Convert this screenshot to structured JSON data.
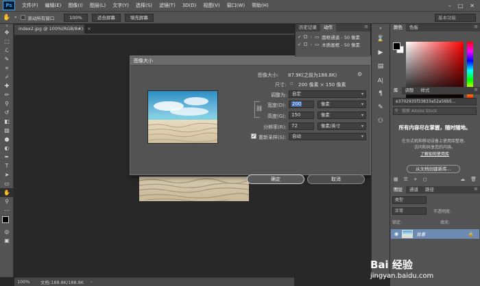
{
  "menu": {
    "logo": "Ps",
    "items": [
      "文件(F)",
      "编辑(E)",
      "图像(I)",
      "图层(L)",
      "文字(Y)",
      "选择(S)",
      "滤镜(T)",
      "3D(D)",
      "视图(V)",
      "窗口(W)",
      "帮助(H)"
    ],
    "window_controls": [
      "–",
      "□",
      "✕"
    ]
  },
  "options": {
    "scroll_all_windows": "滚动所有窗口",
    "zoom_value": "100%",
    "fit_screen": "适合屏幕",
    "fill_screen": "填充屏幕",
    "workspace": "基本功能"
  },
  "document": {
    "tab_title": "index2.jpg @ 100%(RGB/8#)",
    "tab_close": "×"
  },
  "status": {
    "zoom": "100%",
    "doc_size": "文档:188.8K/188.8K",
    "arrow": "›"
  },
  "history_panel": {
    "tabs": [
      "历史记录",
      "动作"
    ],
    "rows": [
      {
        "check": "✓",
        "label": "圆框通道 - 50 像素"
      },
      {
        "check": "✓",
        "label": "木质画框 - 50 像素"
      }
    ]
  },
  "dialog": {
    "title": "图像大小",
    "image_size_label": "图像大小:",
    "image_size_value": "87.9K(之前为188.8K)",
    "dimensions_label": "尺寸:",
    "dimensions_value": "200 像素 × 150 像素",
    "fit_to_label": "调整为:",
    "fit_to_value": "自定",
    "width_label": "宽度(D):",
    "width_value": "200",
    "width_unit": "像素",
    "height_label": "高度(G):",
    "height_value": "150",
    "height_unit": "像素",
    "resolution_label": "分辨率(R):",
    "resolution_value": "72",
    "resolution_unit": "像素/英寸",
    "resample_label": "重新采样(S):",
    "resample_value": "自动",
    "resample_checked": true,
    "ok": "确定",
    "cancel": "取消"
  },
  "color_panel": {
    "tabs": [
      "颜色",
      "色板"
    ],
    "foreground": "#000000",
    "background": "#ffffff"
  },
  "library_panel": {
    "tabs": [
      "库",
      "调整",
      "样式"
    ],
    "library_id": "e3702935f33833a52a56b5...",
    "search_placeholder": "搜索 Adobe Stock",
    "headline": "所有内容尽在掌握，随时随地。",
    "desc_line1": "在台式机和移动设备上使用库整理、",
    "desc_line2": "访问和共享您的内容。",
    "learn_more": "了解如何使用库",
    "create_btn": "从文档创建新库..."
  },
  "layers_panel": {
    "tabs": [
      "图层",
      "通道",
      "路径"
    ],
    "kind": "类型",
    "blend_mode": "正常",
    "opacity": "不透明度:",
    "lock_label": "锁定:",
    "fill": "填充:",
    "layer_name": "背景"
  },
  "watermark": {
    "brand": "Bai 经验",
    "url": "jingyan.baidu.com"
  }
}
